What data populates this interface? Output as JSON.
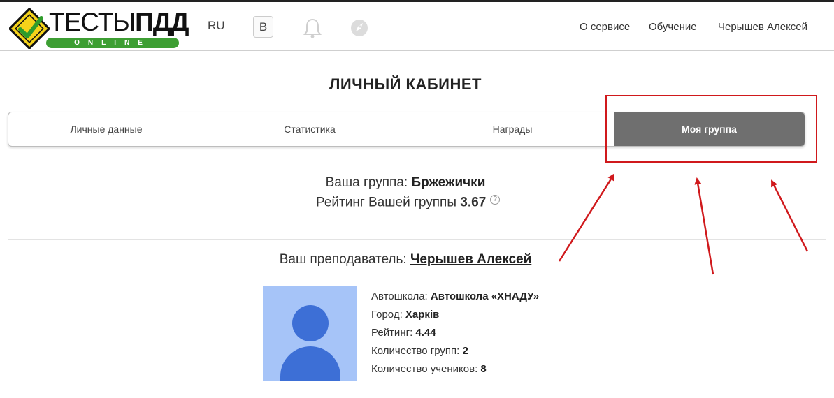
{
  "header": {
    "logo": {
      "main_light": "ТЕСТЫ",
      "main_bold": "ПДД",
      "sub": "ONLINE"
    },
    "lang": "RU",
    "vk_label": "В",
    "nav": [
      "О сервисе",
      "Обучение",
      "Черышев Алексей"
    ]
  },
  "page": {
    "title": "ЛИЧНЫЙ КАБИНЕТ",
    "tabs": [
      "Личные данные",
      "Статистика",
      "Награды",
      "Моя группа"
    ],
    "active_tab": "Моя группа"
  },
  "group": {
    "label": "Ваша группа:",
    "name": "Бржежички",
    "rating_label": "Рейтинг Вашей группы",
    "rating_value": "3.67",
    "help": "?"
  },
  "teacher": {
    "label": "Ваш преподаватель:",
    "name": "Черышев Алексей",
    "info": [
      {
        "label": "Автошкола:",
        "value": "Автошкола «ХНАДУ»"
      },
      {
        "label": "Город:",
        "value": "Харків"
      },
      {
        "label": "Рейтинг:",
        "value": "4.44"
      },
      {
        "label": "Количество групп:",
        "value": "2"
      },
      {
        "label": "Количество учеников:",
        "value": "8"
      }
    ]
  },
  "colors": {
    "accent_green": "#3d9e33",
    "active_tab": "#6f6f6f",
    "annotation_red": "#d0191c",
    "avatar_bg": "#a6c4f8",
    "avatar_fg": "#3d6fd6"
  },
  "icons": [
    "logo-diamond-icon",
    "bell-icon",
    "rocket-icon",
    "help-icon",
    "avatar-icon"
  ]
}
